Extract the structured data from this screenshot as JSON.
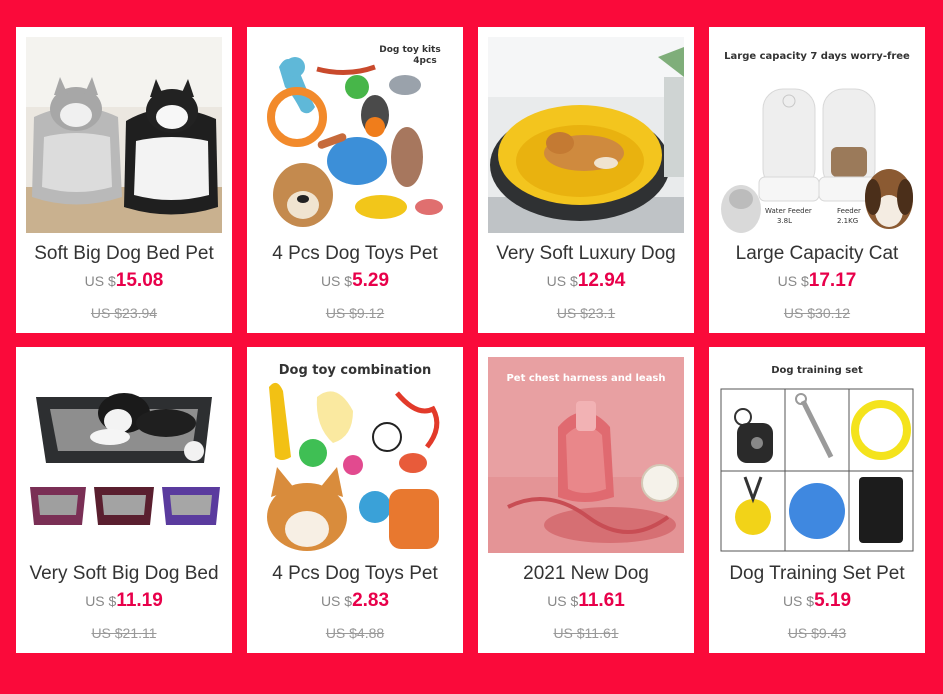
{
  "colors": {
    "background": "#fa0a3a",
    "price": "#e8004a",
    "title": "#333333",
    "muted": "#999999"
  },
  "products": [
    {
      "title": "Soft Big Dog Bed Pet",
      "currency": "US $",
      "price": "15.08",
      "original_price": "US $23.94",
      "image": "husky-dog-bed-photo"
    },
    {
      "title": "4 Pcs Dog Toys Pet",
      "currency": "US $",
      "price": "5.29",
      "original_price": "US $9.12",
      "image": "dog-toy-kit-photo",
      "image_text": [
        "Dog toy kits",
        "4pcs"
      ]
    },
    {
      "title": "Very Soft Luxury Dog",
      "currency": "US $",
      "price": "12.94",
      "original_price": "US $23.1",
      "image": "yellow-round-dog-bed-photo"
    },
    {
      "title": "Large Capacity Cat",
      "currency": "US $",
      "price": "17.17",
      "original_price": "US $30.12",
      "image": "pet-water-feeder-photo",
      "image_text": [
        "Large capacity 7 days worry-free",
        "Water Feeder",
        "3.8L",
        "Feeder",
        "2.1KG"
      ]
    },
    {
      "title": "Very Soft Big Dog Bed",
      "currency": "US $",
      "price": "11.19",
      "original_price": "US $21.11",
      "image": "rectangle-dog-bed-photo"
    },
    {
      "title": "4 Pcs Dog Toys Pet",
      "currency": "US $",
      "price": "2.83",
      "original_price": "US $4.88",
      "image": "dog-toy-combination-photo",
      "image_text": [
        "Dog toy combination"
      ]
    },
    {
      "title": "2021 New Dog",
      "currency": "US $",
      "price": "11.61",
      "original_price": "US $11.61",
      "image": "pet-harness-leash-photo",
      "image_text": [
        "Pet chest harness and leash"
      ]
    },
    {
      "title": "Dog Training Set Pet",
      "currency": "US $",
      "price": "5.19",
      "original_price": "US $9.43",
      "image": "dog-training-set-photo",
      "image_text": [
        "Dog training set"
      ]
    }
  ]
}
